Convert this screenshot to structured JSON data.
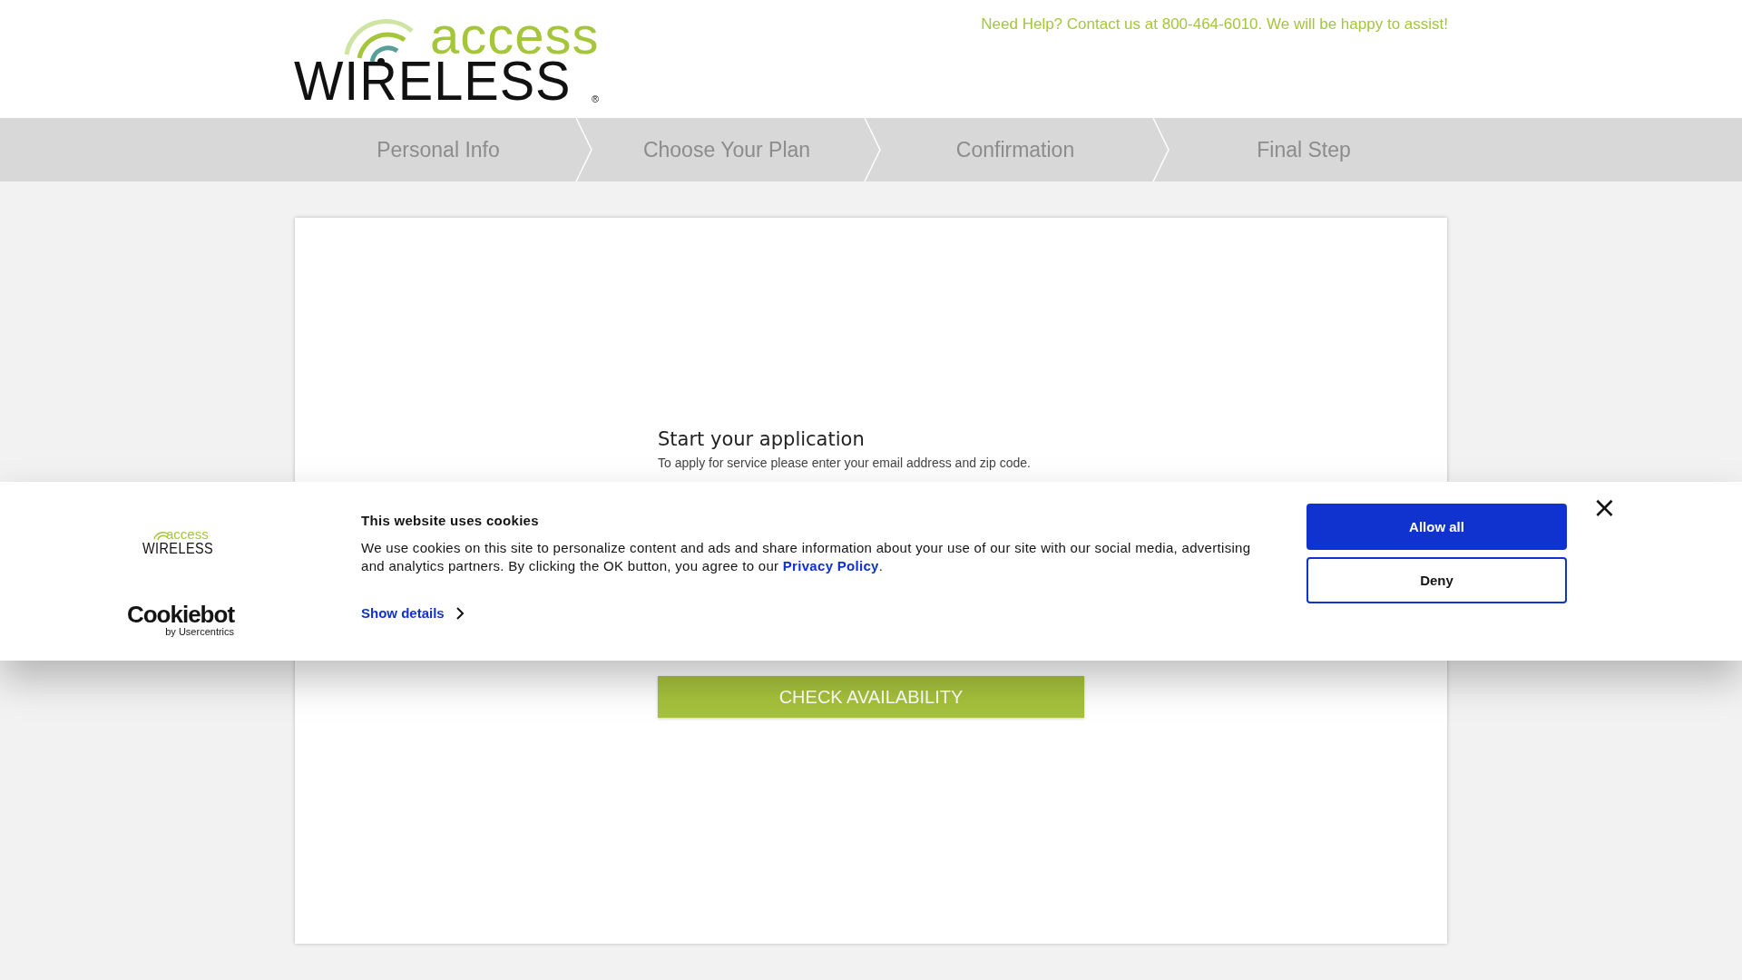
{
  "header": {
    "logo": {
      "top": "access",
      "bottom": "WIRELESS",
      "mark": "®"
    },
    "help_text": "Need Help? Contact us at 800-464-6010. We will be happy to assist!"
  },
  "steps": [
    {
      "label": "Personal Info"
    },
    {
      "label": "Choose Your Plan"
    },
    {
      "label": "Confirmation"
    },
    {
      "label": "Final Step"
    }
  ],
  "application": {
    "title": "Start your application",
    "subtitle": "To apply for service please enter your email address and zip code.",
    "button": "CHECK AVAILABILITY"
  },
  "cookie_banner": {
    "logo": {
      "top": "access",
      "bottom": "WIRELESS"
    },
    "title": "This website uses cookies",
    "text": "We use cookies on this site to personalize content and ads and share information about your use of our site with our social media, advertising and analytics partners. By clicking the OK button, you agree to our ",
    "link": "Privacy Policy",
    "text_end": ".",
    "details": "Show details",
    "brand": "Cookiebot",
    "brand_sub": "by Usercentrics",
    "buttons": [
      {
        "label": "Allow all",
        "kind": "primary"
      },
      {
        "label": "Deny",
        "kind": "outline"
      }
    ],
    "close": "×"
  }
}
